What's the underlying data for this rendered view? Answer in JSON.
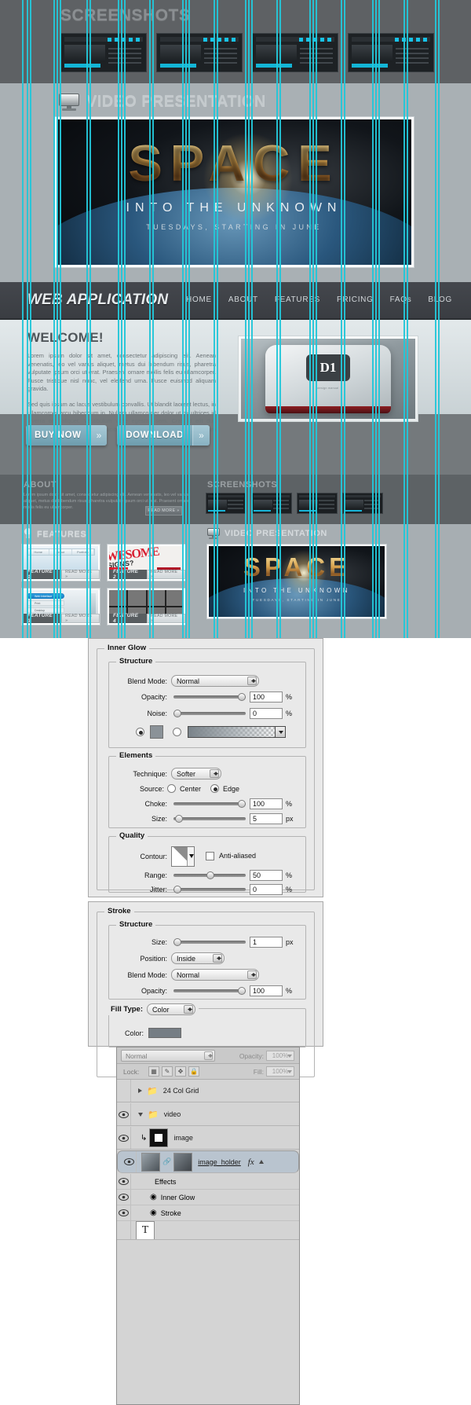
{
  "mockup": {
    "screenshots_band": {
      "title": "SCREENSHOTS"
    },
    "video_band": {
      "title": "VIDEO PRESENTATION",
      "icon": "monitor-icon"
    },
    "poster": {
      "word": "SPACE",
      "tagline": "INTO THE UNKNOWN",
      "schedule": "TUESDAYS, STARTING IN JUNE"
    },
    "site": {
      "logo": "WEB APPLICATION",
      "nav": [
        "HOME",
        "ABOUT",
        "FEATURES",
        "PRICING",
        "FAQs",
        "BLOG"
      ],
      "welcome": {
        "heading": "WELCOME!",
        "p1": "Lorem ipsum dolor sit amet, consectetur adipiscing elit. Aenean venenatis, leo vel varius aliquet, metus dui bibendum risus, pharetra vulputate ipsum orci ut erat. Praesent ornare mollis felis eu ullamcorper. Fusce tristique nisl nunc, vel eleifend urna. Fusce euismod aliquam gravida.",
        "p2": "Sed quis ipsum ac lacus vestibulum convallis. Ut blandit laoreet lectus, in ullamcorper arcu bibendum in. Nullam ullamcorper dolor ut mi ultrices id viverra orci aliquet. Vestibulum vitae egestas sem. Cras id elit dui. Praesent id odio eget justo faucibus convallis. Suspendisse elementum nibh non odio pharetra."
      },
      "device": {
        "badge": "D1",
        "caption": "design manual"
      },
      "buttons": [
        {
          "label": "BUY NOW",
          "arrow": "»"
        },
        {
          "label": "DOWNLOAD",
          "arrow": "»"
        }
      ],
      "about": {
        "title": "ABOUT",
        "text": "Lorem ipsum dolor sit amet, consectetur adipiscing elit. Aenean venenatis, leo vel varius aliquet, metus dui bibendum risus, pharetra vulputate ipsum orci ut erat. Praesent ornare mollis felis eu ullamcorper.",
        "read_more": "READ MORE »"
      },
      "screenshots": {
        "title": "SCREENSHOTS"
      },
      "features": {
        "title": "FEATURES",
        "icon": "lightbulb-icon",
        "items": [
          {
            "name": "FEATURE 1",
            "read_more": "READ MORE »"
          },
          {
            "name": "FEATURE 2",
            "read_more": "READ MORE »"
          },
          {
            "name": "FEATURE 3",
            "read_more": "READ MORE »"
          },
          {
            "name": "FEATURE 4",
            "read_more": "READ MORE »"
          }
        ],
        "tile1_nav": [
          "Home",
          "About",
          "Portfolio"
        ],
        "tile2_word": "WESOME",
        "tile2_word2": "SIGNS?",
        "tile3_items": [
          "Web Interface",
          "Print",
          "Desktop",
          "Phone"
        ]
      },
      "video2": {
        "title": "VIDEO PRESENTATION"
      }
    }
  },
  "inner_glow": {
    "title": "Inner Glow",
    "structure": {
      "legend": "Structure",
      "blend_mode_label": "Blend Mode:",
      "blend_mode_value": "Normal",
      "opacity_label": "Opacity:",
      "opacity_value": "100",
      "opacity_unit": "%",
      "noise_label": "Noise:",
      "noise_value": "0",
      "noise_unit": "%",
      "fill_color_selected": true,
      "fill_gradient_selected": false
    },
    "elements": {
      "legend": "Elements",
      "technique_label": "Technique:",
      "technique_value": "Softer",
      "source_label": "Source:",
      "source_center": "Center",
      "source_edge": "Edge",
      "source_selected": "Edge",
      "choke_label": "Choke:",
      "choke_value": "100",
      "choke_unit": "%",
      "size_label": "Size:",
      "size_value": "5",
      "size_unit": "px"
    },
    "quality": {
      "legend": "Quality",
      "contour_label": "Contour:",
      "anti_aliased_label": "Anti-aliased",
      "anti_aliased_checked": false,
      "range_label": "Range:",
      "range_value": "50",
      "range_unit": "%",
      "jitter_label": "Jitter:",
      "jitter_value": "0",
      "jitter_unit": "%"
    }
  },
  "stroke": {
    "title": "Stroke",
    "structure": {
      "legend": "Structure",
      "size_label": "Size:",
      "size_value": "1",
      "size_unit": "px",
      "position_label": "Position:",
      "position_value": "Inside",
      "blend_mode_label": "Blend Mode:",
      "blend_mode_value": "Normal",
      "opacity_label": "Opacity:",
      "opacity_value": "100",
      "opacity_unit": "%"
    },
    "fill": {
      "fill_type_label": "Fill Type:",
      "fill_type_value": "Color",
      "color_label": "Color:",
      "color_value": "#757d84"
    }
  },
  "layers_panel": {
    "blend_mode": "Normal",
    "opacity_label": "Opacity:",
    "opacity_value": "100%",
    "lock_label": "Lock:",
    "fill_label": "Fill:",
    "fill_value": "100%",
    "lock_icons": [
      "lock-transparent-icon",
      "lock-brush-icon",
      "lock-move-icon",
      "lock-all-icon"
    ],
    "rows": [
      {
        "name": "24 Col Grid",
        "type": "group",
        "visible": false,
        "expanded": false
      },
      {
        "name": "video",
        "type": "group",
        "visible": true,
        "expanded": true
      },
      {
        "name": "image",
        "type": "layer",
        "visible": true,
        "clipped": true
      },
      {
        "name": "image_holder",
        "type": "layer",
        "visible": true,
        "selected": true,
        "has_fx": true
      },
      {
        "name": "Effects",
        "type": "effects"
      },
      {
        "name": "Inner Glow",
        "type": "effect"
      },
      {
        "name": "Stroke",
        "type": "effect"
      }
    ]
  }
}
